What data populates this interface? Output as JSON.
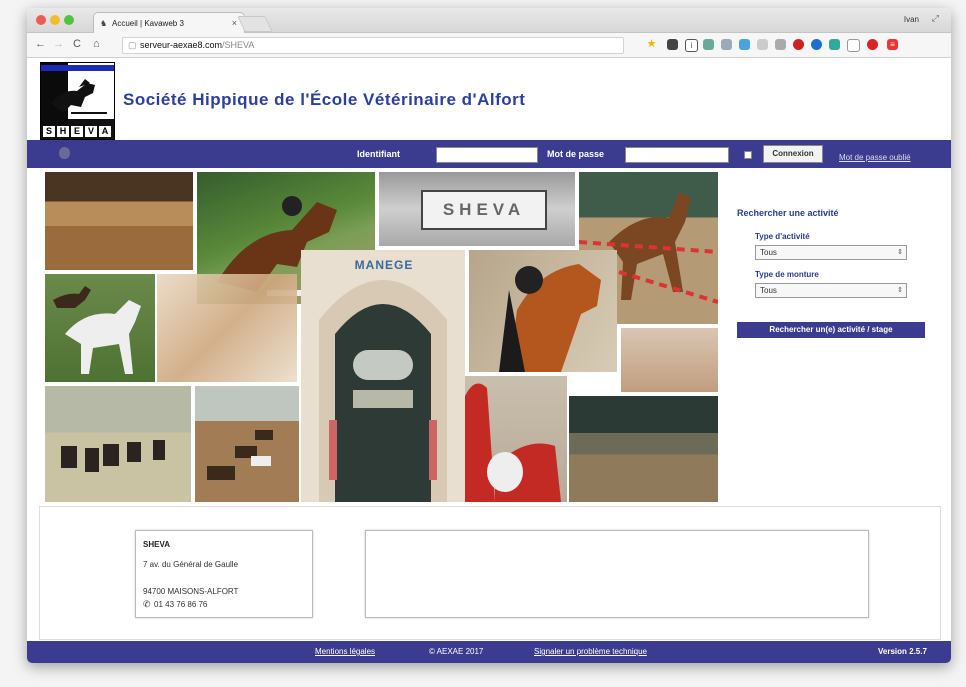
{
  "browser": {
    "tab_title": "Accueil | Kavaweb 3",
    "url_host": "serveur-aexae8.com",
    "url_path": "/SHEVA",
    "user_label": "Ivan"
  },
  "site": {
    "title": "Société Hippique de l'École Vétérinaire d'Alfort",
    "logo_letters": [
      "S",
      "H",
      "E",
      "V",
      "A"
    ]
  },
  "login": {
    "identifiant_label": "Identifiant",
    "password_label": "Mot de passe",
    "connect_label": "Connexion",
    "forgot_label": "Mot de passe oublié"
  },
  "collage": {
    "sheva_sign": "SHEVA",
    "manege_sign": "MANEGE"
  },
  "search": {
    "title": "Rechercher une activité",
    "activity_type_label": "Type d'activité",
    "activity_type_value": "Tous",
    "mount_type_label": "Type de monture",
    "mount_type_value": "Tous",
    "submit_label": "Rechercher un(e) activité / stage"
  },
  "contact": {
    "name": "SHEVA",
    "street": "7 av. du Général de Gaulle",
    "city": "94700 MAISONS-ALFORT",
    "phone": "01 43 76 86 76"
  },
  "footer": {
    "legal": "Mentions légales",
    "copyright": "© AEXAE 2017",
    "report": "Signaler un problème technique",
    "version": "Version 2.5.7"
  }
}
